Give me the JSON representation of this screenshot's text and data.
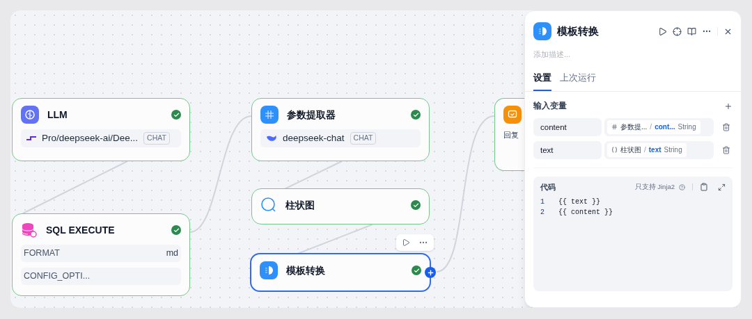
{
  "nodes": [
    {
      "kind": "llm",
      "title": "LLM",
      "selected": false,
      "succeeded": true,
      "model": "Pro/deepseek-ai/Dee...",
      "model_tag": "CHAT"
    },
    {
      "kind": "extractor",
      "title": "参数提取器",
      "selected": false,
      "succeeded": true,
      "model": "deepseek-chat",
      "model_tag": "CHAT"
    },
    {
      "kind": "chart",
      "title": "柱状图",
      "selected": false,
      "succeeded": true
    },
    {
      "kind": "sql",
      "title": "SQL EXECUTE",
      "selected": false,
      "succeeded": true,
      "params": [
        {
          "name": "FORMAT",
          "value": "md"
        },
        {
          "name": "CONFIG_OPTI..."
        }
      ]
    },
    {
      "kind": "template",
      "title": "模板转换",
      "selected": true,
      "succeeded": true
    },
    {
      "kind": "answer",
      "selected": false,
      "label": "回复"
    }
  ],
  "panel": {
    "title": "模板转换",
    "description_placeholder": "添加描述...",
    "tabs": [
      {
        "label": "设置",
        "selected": true
      },
      {
        "label": "上次运行",
        "selected": false
      }
    ],
    "inputs_title": "输入变量",
    "inputs": [
      {
        "name": "content",
        "kind": "node",
        "source": "参数提...",
        "separator": "/",
        "variable": "cont...",
        "type": "String"
      },
      {
        "name": "text",
        "kind": "variable",
        "source": "柱状图",
        "separator": "/",
        "variable": "text",
        "type": "String"
      }
    ],
    "code": {
      "title": "代码",
      "hint": "只支持 Jinja2",
      "lines": [
        {
          "number": "1",
          "text": "{{ text }}"
        },
        {
          "number": "2",
          "text": "{{ content }}"
        }
      ]
    }
  }
}
